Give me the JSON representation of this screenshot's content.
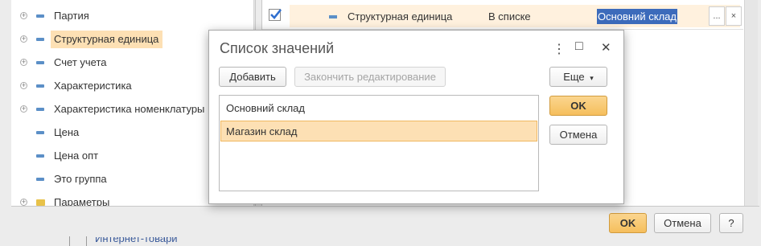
{
  "tree": {
    "items": [
      {
        "label": "Партия",
        "expandable": true,
        "icon": "dash"
      },
      {
        "label": "Структурная единица",
        "expandable": true,
        "icon": "dash",
        "selected": true
      },
      {
        "label": "Счет учета",
        "expandable": true,
        "icon": "dash"
      },
      {
        "label": "Характеристика",
        "expandable": true,
        "icon": "dash"
      },
      {
        "label": "Характеристика номенклатуры",
        "expandable": true,
        "icon": "dash"
      },
      {
        "label": "Цена",
        "expandable": false,
        "icon": "dash"
      },
      {
        "label": "Цена опт",
        "expandable": false,
        "icon": "dash"
      },
      {
        "label": "Это группа",
        "expandable": false,
        "icon": "dash"
      },
      {
        "label": "Параметры",
        "expandable": true,
        "icon": "folder"
      }
    ]
  },
  "table": {
    "row": {
      "checked": true,
      "field": "Структурная единица",
      "condition": "В списке",
      "value": "Основний склад",
      "select_label": "...",
      "clear_label": "×"
    }
  },
  "dialog": {
    "title": "Список значений",
    "more_icon": "⋮",
    "maximize_icon": "□",
    "close_icon": "✕",
    "add_label": "Добавить",
    "finish_edit_label": "Закончить редактирование",
    "more_label": "Еще",
    "more_arrow": "▾",
    "items": [
      "Основний склад",
      "Магазин склад"
    ],
    "selected_index": 1,
    "ok_label": "OK",
    "cancel_label": "Отмена"
  },
  "bottom": {
    "ok_label": "OK",
    "cancel_label": "Отмена",
    "help_label": "?",
    "peek_text": "Интернет-товари"
  },
  "colors": {
    "accent": "#f5be5c",
    "selection": "#fde0b4",
    "value_highlight": "#3c6bbb"
  }
}
